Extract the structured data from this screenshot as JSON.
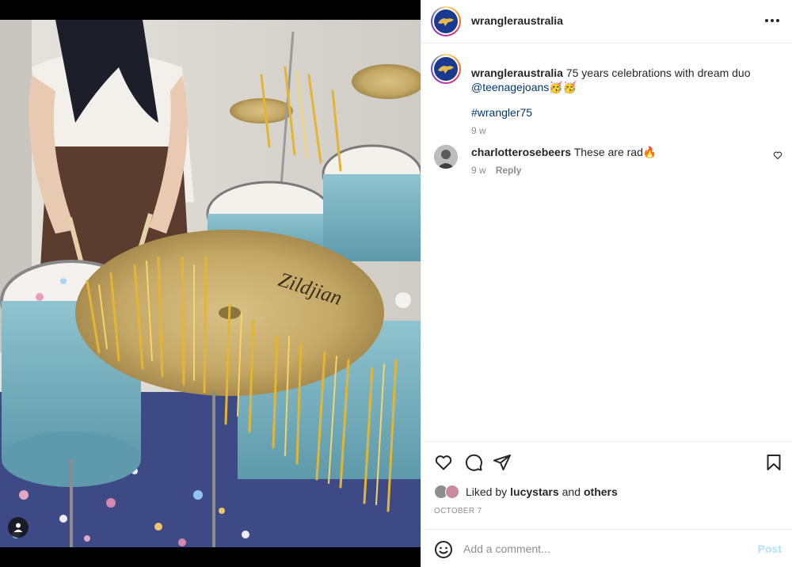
{
  "post": {
    "username": "wrangleraustralia",
    "caption": {
      "username": "wrangleraustralia",
      "text": " 75 years celebrations with dream duo ",
      "mention": "@teenagejoans",
      "emoji": "🥳🥳",
      "hashtag": "#wrangler75",
      "time": "9 w"
    },
    "comments": [
      {
        "username": "charlotterosebeers",
        "text": " These are rad🔥",
        "time": "9 w",
        "reply_label": "Reply"
      }
    ],
    "likes": {
      "prefix": "Liked by ",
      "user": "lucystars",
      "connector": " and ",
      "others": "others"
    },
    "date": "OCTOBER 7",
    "add_comment": {
      "placeholder": "Add a comment...",
      "post_label": "Post"
    }
  },
  "icons": {
    "more": "more-options-icon",
    "like": "heart-icon",
    "comment": "comment-icon",
    "share": "send-icon",
    "save": "bookmark-icon",
    "emoji": "smiley-icon",
    "tag": "user-tag-icon"
  },
  "colors": {
    "link": "#00376b",
    "secondary_text": "#8e8e8e",
    "post_button_disabled": "#b2dffc",
    "brand_logo_bg": "#1a3a8f"
  }
}
